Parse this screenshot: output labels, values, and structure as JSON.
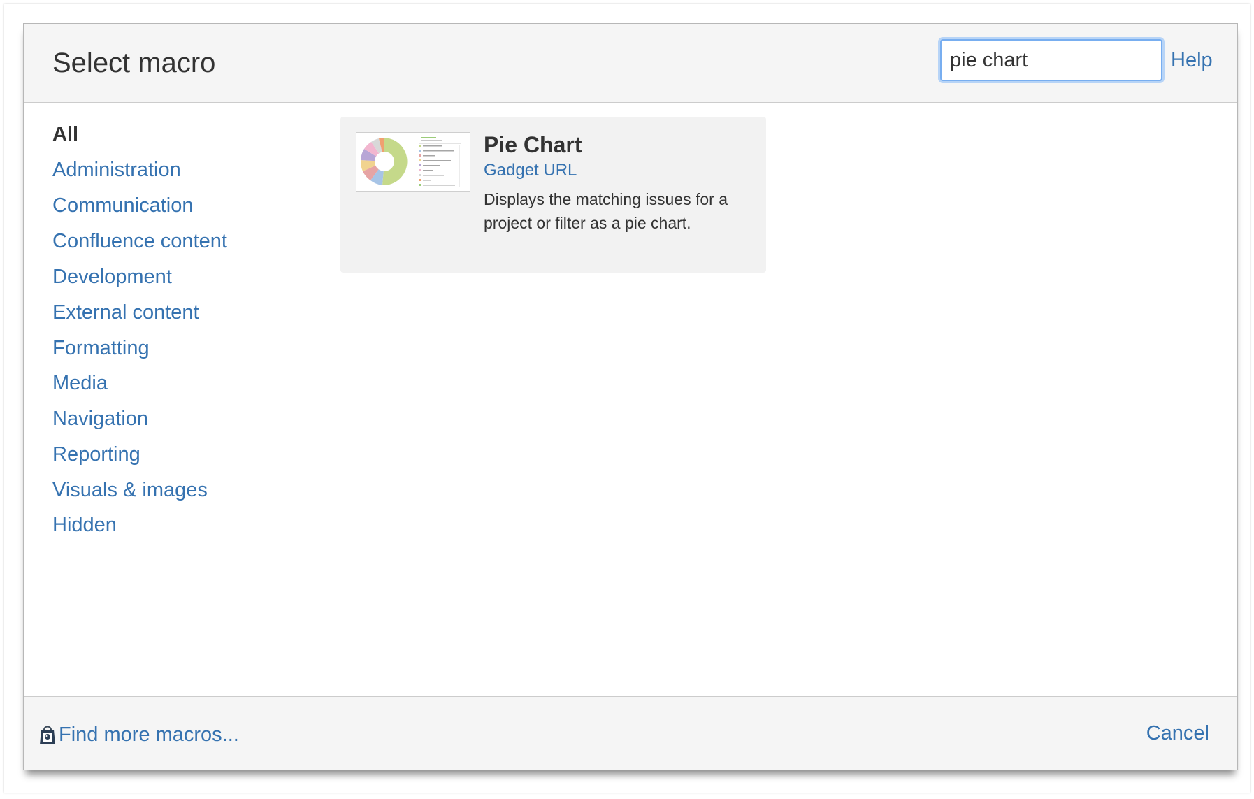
{
  "dialog": {
    "title": "Select macro",
    "search": {
      "value": "pie chart"
    },
    "help_label": "Help"
  },
  "sidebar": {
    "categories": [
      {
        "label": "All",
        "active": true
      },
      {
        "label": "Administration"
      },
      {
        "label": "Communication"
      },
      {
        "label": "Confluence content"
      },
      {
        "label": "Development"
      },
      {
        "label": "External content"
      },
      {
        "label": "Formatting"
      },
      {
        "label": "Media"
      },
      {
        "label": "Navigation"
      },
      {
        "label": "Reporting"
      },
      {
        "label": "Visuals & images"
      },
      {
        "label": "Hidden"
      }
    ]
  },
  "results": [
    {
      "name": "Pie Chart",
      "link": "Gadget URL",
      "description": "Displays the matching issues for a project or filter as a pie chart.",
      "thumbnail_icon": "pie-chart-gadget-thumbnail"
    }
  ],
  "footer": {
    "find_more_label": "Find more macros...",
    "find_more_icon": "marketplace-bag-icon",
    "cancel_label": "Cancel"
  },
  "colors": {
    "link": "#3572b0",
    "text": "#333333",
    "panel": "#f5f5f5",
    "card": "#f2f2f2",
    "focus": "#78aef0"
  }
}
